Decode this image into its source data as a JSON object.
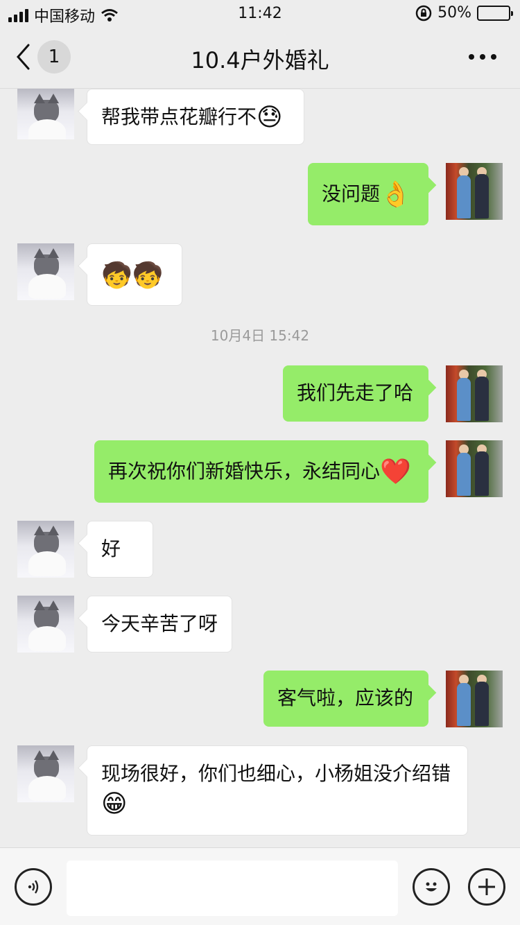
{
  "status_bar": {
    "carrier": "中国移动",
    "time": "11:42",
    "battery": "50%",
    "battery_level": 0.5
  },
  "nav": {
    "unread_count": "1",
    "title": "10.4户外婚礼",
    "back_icon": "chevron-left-icon",
    "more_icon": "more-dots-icon"
  },
  "messages": [
    {
      "side": "in",
      "text": "帮我带点花瓣行不",
      "emoji": "😓"
    },
    {
      "side": "out",
      "text": "没问题",
      "emoji": "👌"
    },
    {
      "side": "in",
      "text": "",
      "emoji": "🧒🧒"
    },
    {
      "side": "out",
      "text": "我们先走了哈",
      "emoji": ""
    },
    {
      "side": "out",
      "text": "再次祝你们新婚快乐，永结同心",
      "emoji": "❤️"
    },
    {
      "side": "in",
      "text": "好",
      "emoji": ""
    },
    {
      "side": "in",
      "text": "今天辛苦了呀",
      "emoji": ""
    },
    {
      "side": "out",
      "text": "客气啦，应该的",
      "emoji": ""
    },
    {
      "side": "in",
      "text": "现场很好，你们也细心，小杨姐没介绍错",
      "emoji": "😁"
    }
  ],
  "timestamp": "10月4日 15:42",
  "input_bar": {
    "placeholder": "",
    "voice_icon": "voice-icon",
    "emoji_icon": "smiley-icon",
    "plus_icon": "plus-icon"
  },
  "colors": {
    "outgoing_bubble": "#95ec69",
    "incoming_bubble": "#ffffff",
    "background": "#ededed"
  }
}
